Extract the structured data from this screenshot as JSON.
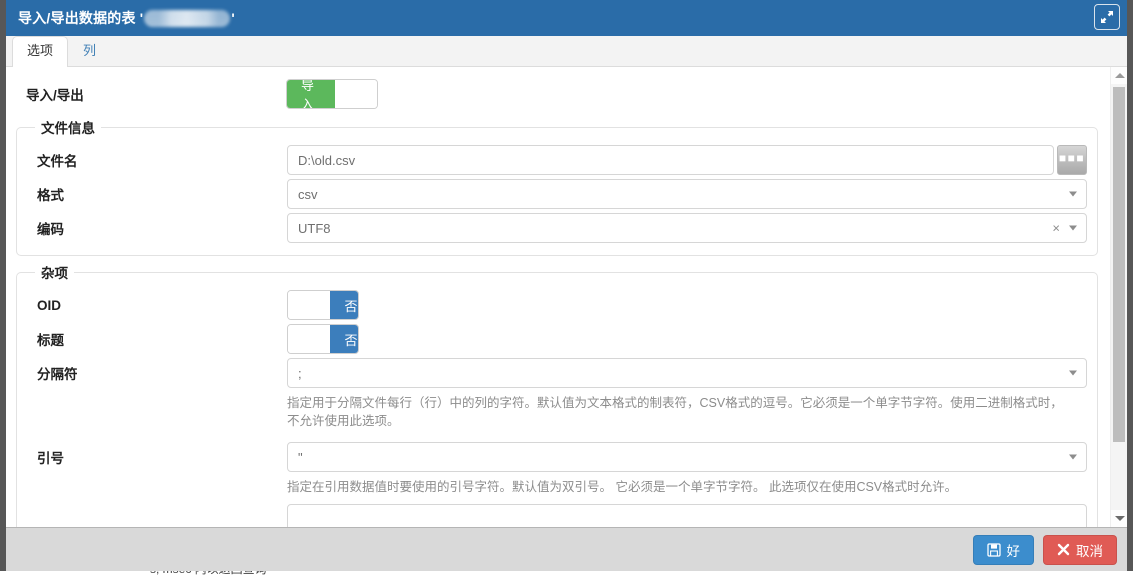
{
  "background": {
    "text": "s, msec 内以返回查询"
  },
  "titlebar": {
    "prefix": "导入/导出数据的表 '",
    "suffix": "'",
    "redacted_name": "",
    "maximize_icon": "maximize-diagonal-icon",
    "bg_color": "#2a6ca8"
  },
  "tabs": [
    {
      "label": "选项",
      "active": true
    },
    {
      "label": "列",
      "active": false
    }
  ],
  "form": {
    "mode_row": {
      "label": "导入/导出",
      "toggle": {
        "on_label": "导入",
        "state": "on-left",
        "color": "#5cb85c"
      }
    },
    "file_info": {
      "legend": "文件信息",
      "filename": {
        "label": "文件名",
        "value": "D:\\old.csv",
        "browse_icon": "ellipsis-browse-icon"
      },
      "format": {
        "label": "格式",
        "value": "csv",
        "caret_icon": "chevron-down-icon"
      },
      "encoding": {
        "label": "编码",
        "value": "UTF8",
        "clear_icon": "clear-x-icon",
        "caret_icon": "chevron-down-icon"
      }
    },
    "misc": {
      "legend": "杂项",
      "oid": {
        "label": "OID",
        "toggle": {
          "off_label": "否",
          "state": "on-right",
          "color": "#3c7ebc"
        }
      },
      "header": {
        "label": "标题",
        "toggle": {
          "off_label": "否",
          "state": "on-right",
          "color": "#3c7ebc"
        }
      },
      "delimiter": {
        "label": "分隔符",
        "value": ";",
        "caret_icon": "chevron-down-icon",
        "help": "指定用于分隔文件每行（行）中的列的字符。默认值为文本格式的制表符，CSV格式的逗号。它必须是一个单字节字符。使用二进制格式时，不允许使用此选项。"
      },
      "quote": {
        "label": "引号",
        "value": "\"",
        "caret_icon": "chevron-down-icon",
        "help": "指定在引用数据值时要使用的引号字符。默认值为双引号。 它必须是一个单字节字符。 此选项仅在使用CSV格式时允许。"
      }
    }
  },
  "scrollbar": {
    "up_icon": "scroll-up-arrow-icon",
    "down_icon": "scroll-down-arrow-icon"
  },
  "footer": {
    "ok": {
      "label": "好",
      "icon": "save-floppy-icon",
      "color": "#3c8dcd"
    },
    "cancel": {
      "label": "取消",
      "icon": "close-x-icon",
      "color": "#e05b55"
    }
  }
}
